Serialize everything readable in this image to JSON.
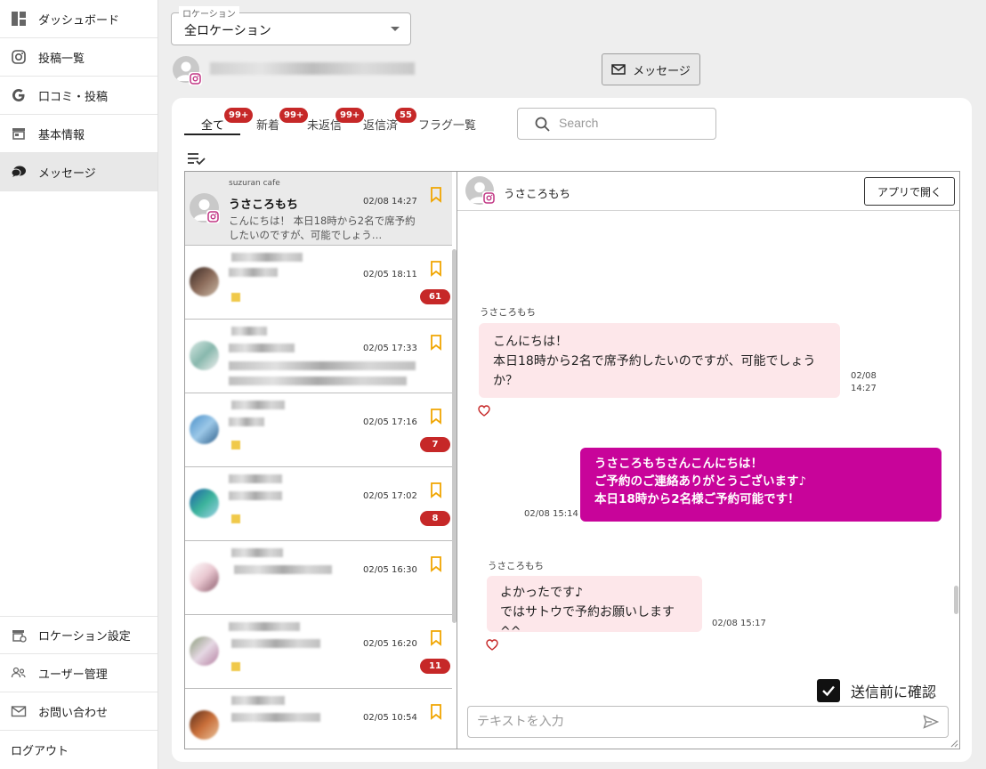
{
  "sidebar": {
    "items": [
      {
        "label": "ダッシュボード",
        "icon": "dashboard-icon"
      },
      {
        "label": "投稿一覧",
        "icon": "instagram-icon"
      },
      {
        "label": "口コミ・投稿",
        "icon": "google-icon"
      },
      {
        "label": "基本情報",
        "icon": "store-icon"
      },
      {
        "label": "メッセージ",
        "icon": "chat-icon"
      }
    ],
    "bottom_items": [
      {
        "label": "ロケーション設定",
        "icon": "location-settings-icon"
      },
      {
        "label": "ユーザー管理",
        "icon": "users-icon"
      },
      {
        "label": "お問い合わせ",
        "icon": "mail-icon"
      },
      {
        "label": "ログアウト"
      }
    ]
  },
  "location": {
    "legend": "ロケーション",
    "value": "全ロケーション"
  },
  "message_button": {
    "label": "メッセージ"
  },
  "tabs": [
    {
      "label": "全て",
      "badge": "99+"
    },
    {
      "label": "新着",
      "badge": "99+"
    },
    {
      "label": "未返信",
      "badge": "99+"
    },
    {
      "label": "返信済",
      "badge": "55"
    },
    {
      "label": "フラグ一覧"
    }
  ],
  "search": {
    "placeholder": "Search"
  },
  "conversations": [
    {
      "sub": "suzuran cafe",
      "name": "うさころもち",
      "time": "02/08 14:27",
      "preview": "こんにちは！ 本日18時から2名で席予約したいのですが、可能でしょう…"
    },
    {
      "time": "02/05 18:11",
      "count": "61"
    },
    {
      "time": "02/05 17:33"
    },
    {
      "time": "02/05 17:16",
      "count": "7"
    },
    {
      "time": "02/05 17:02",
      "count": "8"
    },
    {
      "time": "02/05 16:30"
    },
    {
      "time": "02/05 16:20",
      "count": "11"
    },
    {
      "time": "02/05 10:54"
    }
  ],
  "chat": {
    "name": "うさころもち",
    "open_app": "アプリで開く",
    "messages": [
      {
        "sender": "うさころもち",
        "line1": "こんにちは！",
        "line2": "本日18時から2名で席予約したいのですが、可能でしょう",
        "line3": "か？",
        "date": "02/08",
        "time": "14:27"
      },
      {
        "line1": "うさころもちさんこんにちは！",
        "line2": "ご予約のご連絡ありがとうございます♪",
        "line3": "本日18時から2名様ご予約可能です！",
        "time": "02/08 15:14"
      },
      {
        "sender": "うさころもち",
        "line1": "よかったです♪",
        "line2": "ではサトウで予約お願いします^^",
        "time": "02/08 15:17"
      }
    ],
    "confirm_label": "送信前に確認",
    "input_placeholder": "テキストを入力"
  },
  "colors": {
    "outgoing_bubble": "#c8049a",
    "incoming_bubble": "#fde7ea",
    "badge": "#c62828",
    "bookmark": "#f0a500"
  }
}
